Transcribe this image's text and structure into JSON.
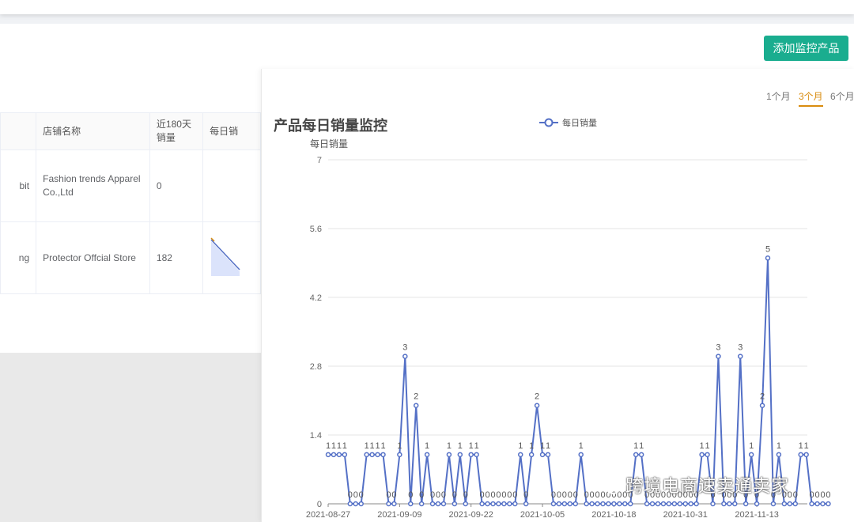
{
  "header": {
    "add_button": "添加监控产品"
  },
  "table": {
    "columns": [
      "店铺名称",
      "近180天销量",
      "每日销"
    ],
    "rows": [
      {
        "left_fragment": "bit",
        "store": "Fashion trends Apparel Co.,Ltd",
        "sales": "0"
      },
      {
        "left_fragment": "ng",
        "store": "Protector Offcial Store",
        "sales": "182"
      }
    ]
  },
  "panel": {
    "range_tabs": [
      "1个月",
      "3个月",
      "6个月"
    ],
    "active_tab": "3个月"
  },
  "watermark": "跨境电商速卖通卖家",
  "colors": {
    "accent": "#1aad8f",
    "series": "#5470c6",
    "active_tab": "#d98c0f"
  },
  "chart_data": {
    "type": "line",
    "title": "产品每日销量监控",
    "ylabel": "每日销量",
    "ylim": [
      0,
      7
    ],
    "yticks": [
      "0",
      "1.4",
      "2.8",
      "4.2",
      "5.6",
      "7"
    ],
    "xtick_labels": [
      "2021-08-27",
      "2021-09-09",
      "2021-09-22",
      "2021-10-05",
      "2021-10-18",
      "2021-10-31",
      "2021-11-13"
    ],
    "x_start": "2021-08-27",
    "series": [
      {
        "name": "每日销量",
        "values": [
          1,
          1,
          1,
          1,
          0,
          0,
          0,
          1,
          1,
          1,
          1,
          0,
          0,
          1,
          3,
          0,
          2,
          0,
          1,
          0,
          0,
          0,
          1,
          0,
          1,
          0,
          1,
          1,
          0,
          0,
          0,
          0,
          0,
          0,
          0,
          1,
          0,
          1,
          2,
          1,
          1,
          0,
          0,
          0,
          0,
          0,
          1,
          0,
          0,
          0,
          0,
          0,
          0,
          0,
          0,
          0,
          1,
          1,
          0,
          0,
          0,
          0,
          0,
          0,
          0,
          0,
          0,
          0,
          1,
          1,
          0,
          3,
          0,
          0,
          0,
          3,
          0,
          1,
          0,
          2,
          5,
          0,
          1,
          0,
          0,
          0,
          1,
          1,
          0,
          0,
          0,
          0
        ]
      }
    ]
  }
}
